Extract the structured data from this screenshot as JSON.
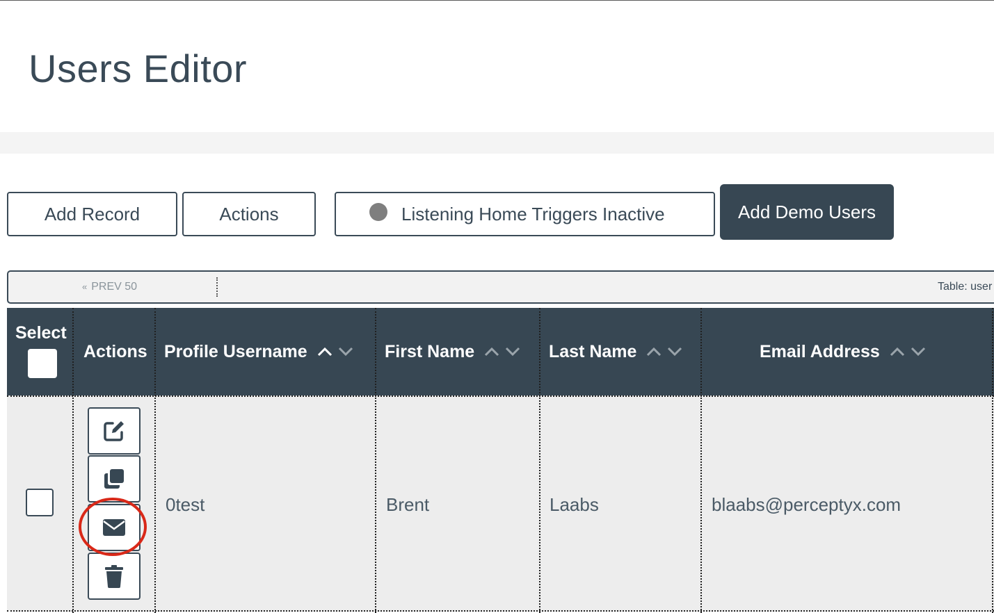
{
  "page": {
    "title": "Users Editor"
  },
  "toolbar": {
    "add_record": "Add Record",
    "actions": "Actions",
    "listening": "Listening Home Triggers Inactive",
    "add_demo_users": "Add Demo Users"
  },
  "pager": {
    "prev_chevron": "«",
    "prev_label": "PREV 50",
    "table_label": "Table: user"
  },
  "table": {
    "headers": {
      "select": "Select",
      "actions": "Actions",
      "profile_username": "Profile Username",
      "first_name": "First Name",
      "last_name": "Last Name",
      "email": "Email Address"
    },
    "rows": [
      {
        "profile_username": "0test",
        "first_name": "Brent",
        "last_name": "Laabs",
        "email": "blaabs@perceptyx.com"
      }
    ],
    "row_action_icons": [
      "edit-icon",
      "copy-icon",
      "envelope-icon",
      "trash-icon"
    ]
  },
  "colors": {
    "header_bg": "#374753",
    "primary": "#374753",
    "annotation": "#d92818",
    "row_bg": "#ededed"
  }
}
